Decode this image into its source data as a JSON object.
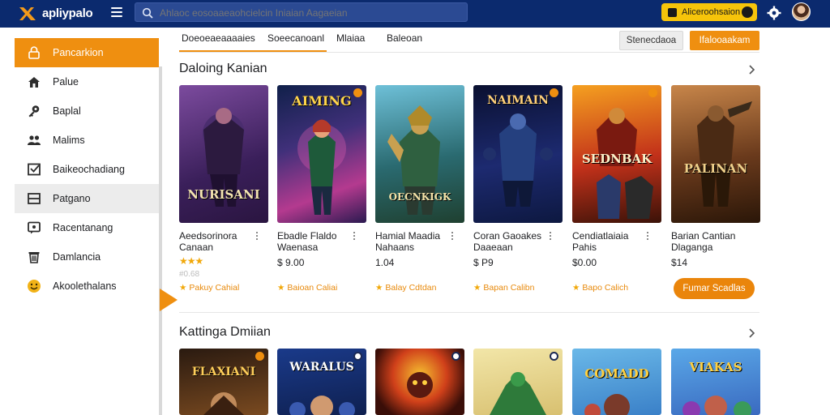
{
  "header": {
    "app_name": "apliypalo",
    "search": {
      "placeholder": "Ahlaoc eosoaaeaohcielcin Iniaian Aagaeian"
    },
    "promo_button": "Aliceroohsaion",
    "icons": [
      "logo-icon",
      "menu-icon",
      "search-icon",
      "gear-icon",
      "avatar"
    ]
  },
  "sidebar": {
    "items": [
      {
        "label": "Pancarkion",
        "icon": "lock-icon",
        "state": "active"
      },
      {
        "label": "Palue",
        "icon": "home-icon"
      },
      {
        "label": "Baplal",
        "icon": "key-icon"
      },
      {
        "label": "Malims",
        "icon": "users-icon"
      },
      {
        "label": "Baikeochadiang",
        "icon": "checkbox-icon"
      },
      {
        "label": "Patgano",
        "icon": "window-icon",
        "state": "hover"
      },
      {
        "label": "Racentanang",
        "icon": "chat-icon"
      },
      {
        "label": "Damlancia",
        "icon": "trash-icon"
      },
      {
        "label": "Akoolethalans",
        "icon": "emoji-icon"
      }
    ]
  },
  "toolbar": {
    "tabs": [
      "Doeoeaeaaaaies",
      "Soeecanoanl",
      "Mlaiaa",
      "Baleoan"
    ],
    "secondary_button": "Stenecdaoa",
    "primary_button": "Ifalooaakam"
  },
  "sections": [
    {
      "title": "Daloing Kanian",
      "cards": [
        {
          "art_text": "NURISANI",
          "name": [
            "Aeedsorinora",
            "Canaan"
          ],
          "price": "",
          "rating": 3,
          "sub": "#0.68",
          "footer": "Pakuy Cahial"
        },
        {
          "art_text": "AIMING",
          "name": [
            "Ebadle Flaldo",
            "Waenasa"
          ],
          "price": "$ 9.00",
          "rating": 0,
          "sub": "",
          "footer": "Baioan Caliai"
        },
        {
          "art_text": "OECNKIGK",
          "name": [
            "Hamial Maadia",
            "Nahaans"
          ],
          "price": "1.04",
          "rating": 0,
          "sub": "",
          "footer": "Balay Cdtdan"
        },
        {
          "art_text": "NAIMAIN",
          "name": [
            "Coran Gaoakes",
            "Daaeaan"
          ],
          "price": "$ P9",
          "rating": 0,
          "sub": "",
          "footer": "Bapan Calibn"
        },
        {
          "art_text": "SEDNBAK",
          "name": [
            "Cendiatlaiaia",
            "Pahis"
          ],
          "price": "$0.00",
          "rating": 0,
          "sub": "",
          "footer": "Bapo Calich"
        },
        {
          "art_text": "PALINAN",
          "name": [
            "Barian Cantian",
            "Dlaganga"
          ],
          "price": "$14",
          "rating": 0,
          "sub": "",
          "footer": "",
          "cta": "Fumar Scadlas"
        }
      ]
    },
    {
      "title": "Kattinga Dmiian",
      "cards": [
        {
          "art_text": "FLAXIANI"
        },
        {
          "art_text": "WARALUS"
        },
        {
          "art_text": ""
        },
        {
          "art_text": ""
        },
        {
          "art_text": "COMADD"
        },
        {
          "art_text": "VIAKAS"
        }
      ]
    }
  ],
  "colors": {
    "header": "#0b2a6e",
    "accent": "#ef8f10",
    "cta": "#ea850b",
    "star": "#f1a80a"
  }
}
